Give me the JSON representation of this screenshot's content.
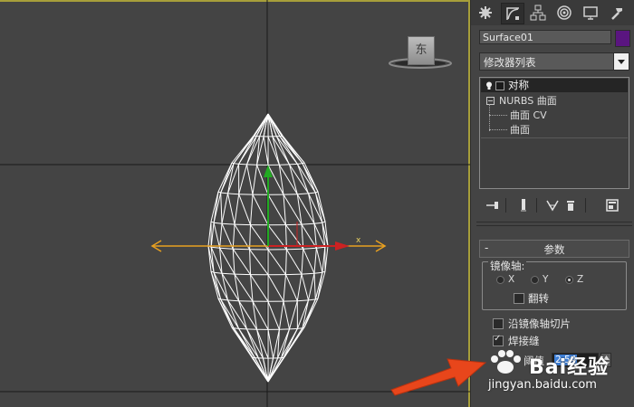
{
  "viewport": {
    "viewcube_label": "东",
    "axis_label": "x",
    "colors": {
      "frame": "#a79e3a",
      "wireframe": "#ffffff",
      "x_axis": "#cc2222",
      "y_axis": "#22aa22",
      "gizmo": "#e8a020"
    }
  },
  "command_panel": {
    "tabs": [
      {
        "icon": "create-icon"
      },
      {
        "icon": "modify-icon",
        "active": true
      },
      {
        "icon": "hierarchy-icon"
      },
      {
        "icon": "motion-icon"
      },
      {
        "icon": "display-icon"
      },
      {
        "icon": "utilities-icon"
      }
    ],
    "object_name": "Surface01",
    "object_color": "#5a1580",
    "modifier_list_label": "修改器列表",
    "stack": {
      "items": [
        {
          "label": "对称",
          "selected": true
        },
        {
          "label": "NURBS 曲面"
        },
        {
          "label": "曲面 CV"
        },
        {
          "label": "曲面"
        }
      ]
    },
    "stack_tools": [
      {
        "icon": "pin-stack-icon"
      },
      {
        "icon": "show-end-result-icon"
      },
      {
        "icon": "make-unique-icon"
      },
      {
        "icon": "remove-modifier-icon"
      },
      {
        "icon": "configure-modifier-sets-icon"
      }
    ],
    "parameters": {
      "rollout_title": "参数",
      "collapse_symbol": "-",
      "mirror_axis": {
        "label": "镜像轴:",
        "options": [
          "X",
          "Y",
          "Z"
        ],
        "selected": "Z"
      },
      "flip_label": "翻转",
      "flip_checked": false,
      "slice_along_mirror_label": "沿镜像轴切片",
      "slice_checked": false,
      "weld_seam_label": "焊接缝",
      "weld_seam_checked": true,
      "threshold_label": "阈值",
      "threshold_value": "2.54"
    }
  },
  "watermark": {
    "brand": "Bai经验",
    "url": "jingyan.baidu.com"
  }
}
